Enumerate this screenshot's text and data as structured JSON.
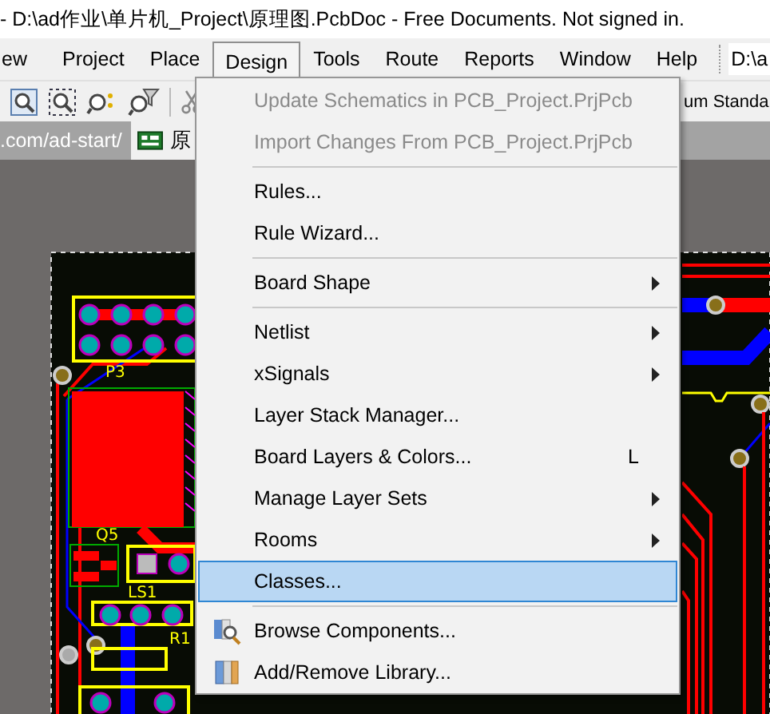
{
  "window": {
    "title": "- D:\\ad作业\\单片机_Project\\原理图.PcbDoc - Free Documents. Not signed in."
  },
  "menu_bar": {
    "items": [
      {
        "label": "ew",
        "selected": false
      },
      {
        "label": "Project",
        "selected": false
      },
      {
        "label": "Place",
        "selected": false
      },
      {
        "label": "Design",
        "selected": true
      },
      {
        "label": "Tools",
        "selected": false
      },
      {
        "label": "Route",
        "selected": false
      },
      {
        "label": "Reports",
        "selected": false
      },
      {
        "label": "Window",
        "selected": false
      },
      {
        "label": "Help",
        "selected": false
      }
    ],
    "path_field": {
      "value": "D:\\a"
    }
  },
  "toolbar": {
    "text": "um Standa"
  },
  "document_bar": {
    "url": ".com/ad-start/",
    "tabs": [
      {
        "label": "原",
        "selected": true
      }
    ]
  },
  "pcb": {
    "labels": [
      "P3",
      "Q5",
      "LS1",
      "R1"
    ]
  },
  "design_menu": {
    "items": [
      {
        "kind": "item",
        "label": "Update Schematics in PCB_Project.PrjPcb",
        "disabled": true,
        "submenu": false,
        "selected": false,
        "icon": false
      },
      {
        "kind": "item",
        "label": "Import Changes From PCB_Project.PrjPcb",
        "disabled": true,
        "submenu": false,
        "selected": false,
        "icon": false
      },
      {
        "kind": "separator"
      },
      {
        "kind": "item",
        "label": "Rules...",
        "disabled": false,
        "submenu": false,
        "selected": false,
        "icon": false
      },
      {
        "kind": "item",
        "label": "Rule Wizard...",
        "disabled": false,
        "submenu": false,
        "selected": false,
        "icon": false
      },
      {
        "kind": "separator"
      },
      {
        "kind": "item",
        "label": "Board Shape",
        "disabled": false,
        "submenu": true,
        "selected": false,
        "icon": false
      },
      {
        "kind": "separator"
      },
      {
        "kind": "item",
        "label": "Netlist",
        "disabled": false,
        "submenu": true,
        "selected": false,
        "icon": false
      },
      {
        "kind": "item",
        "label": "xSignals",
        "disabled": false,
        "submenu": true,
        "selected": false,
        "icon": false
      },
      {
        "kind": "item",
        "label": "Layer Stack Manager...",
        "disabled": false,
        "submenu": false,
        "selected": false,
        "icon": false
      },
      {
        "kind": "item",
        "label": "Board Layers & Colors...",
        "shortcut": "L",
        "disabled": false,
        "submenu": false,
        "selected": false,
        "icon": false
      },
      {
        "kind": "item",
        "label": "Manage Layer Sets",
        "disabled": false,
        "submenu": true,
        "selected": false,
        "icon": false
      },
      {
        "kind": "item",
        "label": "Rooms",
        "disabled": false,
        "submenu": true,
        "selected": false,
        "icon": false
      },
      {
        "kind": "item",
        "label": "Classes...",
        "disabled": false,
        "submenu": false,
        "selected": true,
        "icon": false
      },
      {
        "kind": "separator"
      },
      {
        "kind": "item",
        "label": "Browse Components...",
        "disabled": false,
        "submenu": false,
        "selected": false,
        "icon": true
      },
      {
        "kind": "item",
        "label": "Add/Remove Library...",
        "disabled": false,
        "submenu": false,
        "selected": false,
        "icon": true
      }
    ]
  }
}
